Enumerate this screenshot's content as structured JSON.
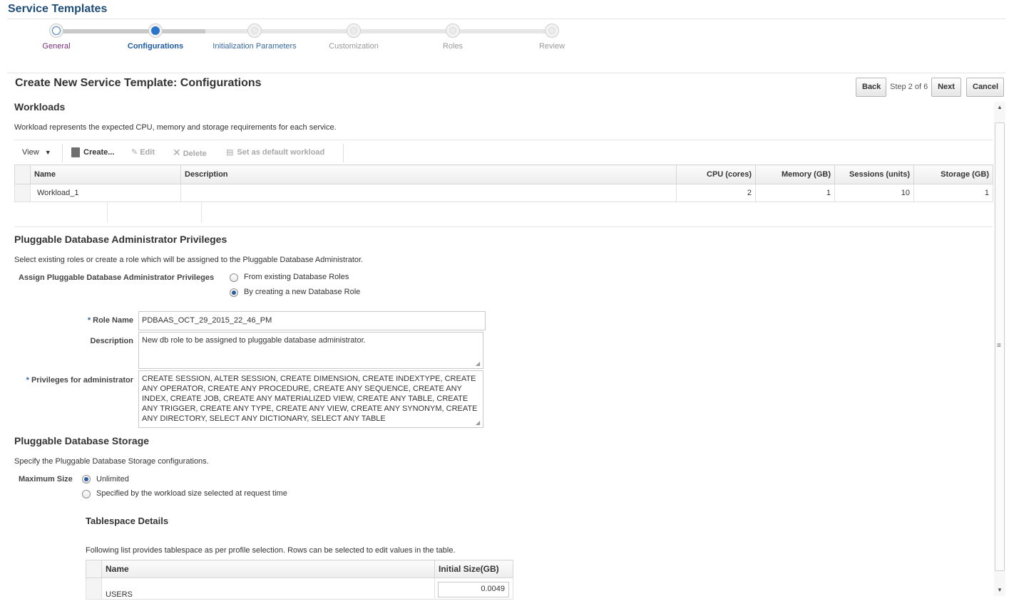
{
  "header": {
    "title": "Service Templates"
  },
  "train": {
    "steps": [
      {
        "label": "General",
        "state": "visited"
      },
      {
        "label": "Configurations",
        "state": "current"
      },
      {
        "label": "Initialization Parameters",
        "state": "next"
      },
      {
        "label": "Customization",
        "state": "pending"
      },
      {
        "label": "Roles",
        "state": "pending"
      },
      {
        "label": "Review",
        "state": "pending"
      }
    ]
  },
  "page": {
    "title": "Create New Service Template: Configurations",
    "step_text": "Step 2 of 6",
    "back_label": "Back",
    "next_label": "Next",
    "cancel_label": "Cancel"
  },
  "workloads": {
    "title": "Workloads",
    "description": "Workload represents the expected CPU, memory and storage requirements for each service.",
    "toolbar": {
      "view": "View",
      "create": "Create...",
      "edit": "Edit",
      "delete": "Delete",
      "set_default": "Set as default workload"
    },
    "columns": [
      "Name",
      "Description",
      "CPU (cores)",
      "Memory (GB)",
      "Sessions (units)",
      "Storage (GB)"
    ],
    "rows": [
      {
        "name": "Workload_1",
        "description": "",
        "cpu": "2",
        "memory": "1",
        "sessions": "10",
        "storage": "1"
      }
    ]
  },
  "pdb_admin": {
    "title": "Pluggable Database Administrator Privileges",
    "description": "Select existing roles or create a role which will be assigned to the Pluggable Database Administrator.",
    "assign_label": "Assign Pluggable Database Administrator Privileges",
    "option_existing": "From existing Database Roles",
    "option_new": "By creating a new Database Role",
    "selected_option": "new",
    "role_name_label": "Role Name",
    "role_name_value": "PDBAAS_OCT_29_2015_22_46_PM",
    "description_label": "Description",
    "description_value": "New db role to be assigned to pluggable database administrator.",
    "privileges_label": "Privileges for administrator",
    "privileges_value": "CREATE SESSION, ALTER SESSION, CREATE DIMENSION, CREATE INDEXTYPE, CREATE ANY OPERATOR, CREATE ANY PROCEDURE, CREATE ANY SEQUENCE, CREATE ANY INDEX, CREATE JOB, CREATE ANY MATERIALIZED VIEW, CREATE ANY TABLE, CREATE ANY TRIGGER, CREATE ANY TYPE, CREATE ANY VIEW, CREATE ANY SYNONYM, CREATE ANY DIRECTORY, SELECT ANY DICTIONARY, SELECT ANY TABLE",
    "required_marker": "*"
  },
  "pdb_storage": {
    "title": "Pluggable Database Storage",
    "description": "Specify the Pluggable Database Storage configurations.",
    "max_size_label": "Maximum Size",
    "option_unlimited": "Unlimited",
    "option_workload": "Specified by the workload size selected at request time",
    "selected_option": "unlimited",
    "tablespace": {
      "title": "Tablespace Details",
      "description": "Following list provides tablespace as per profile selection. Rows can be selected to edit values in the table.",
      "columns": [
        "Name",
        "Initial Size(GB)"
      ],
      "rows": [
        {
          "name": "USERS",
          "initial_size": "0.0049"
        }
      ]
    }
  },
  "colors": {
    "accent": "#2a74c9",
    "header": "#1f4e79",
    "required": "#2a63b3"
  }
}
